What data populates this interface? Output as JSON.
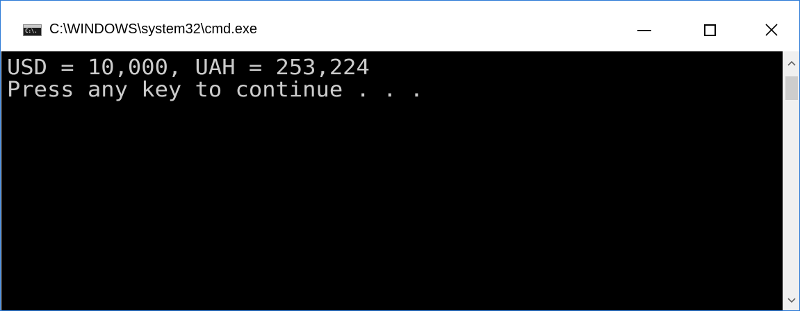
{
  "window": {
    "title": "C:\\WINDOWS\\system32\\cmd.exe",
    "icon": "cmd-app-icon",
    "icon_text": "C:\\.",
    "controls": {
      "minimize": "minimize-icon",
      "maximize": "maximize-icon",
      "close": "close-icon"
    },
    "border_color": "#2b79d6"
  },
  "console": {
    "background": "#000000",
    "text_color": "#cccccc",
    "lines": [
      "USD = 10,000, UAH = 253,224",
      "Press any key to continue . . ."
    ]
  },
  "scrollbar": {
    "up_icon": "chevron-up-icon",
    "down_icon": "chevron-down-icon"
  }
}
